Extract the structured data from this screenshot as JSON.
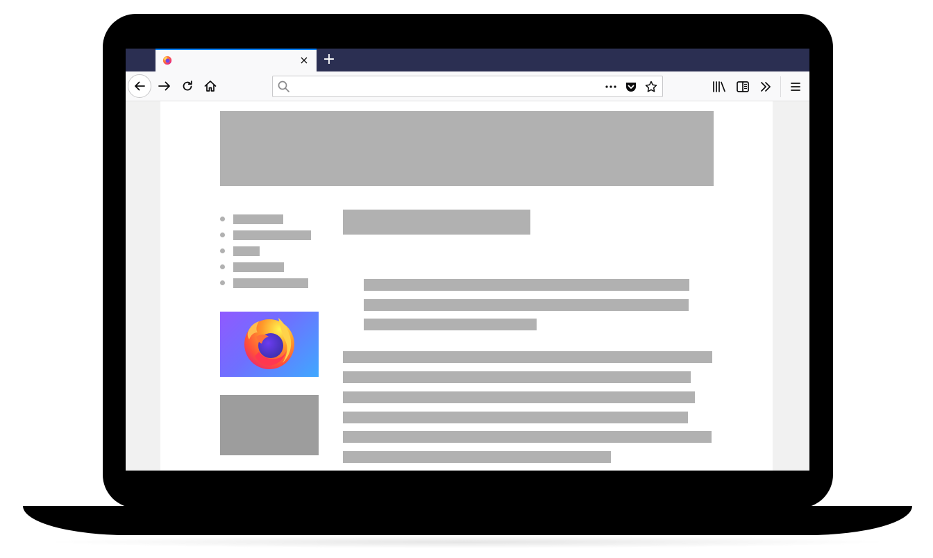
{
  "browser": {
    "tab": {
      "title": "",
      "close_symbol": "×",
      "favicon_icon": "firefox-icon"
    },
    "new_tab_symbol": "+",
    "urlbar": {
      "value": "",
      "placeholder": "",
      "icons": [
        "search-icon",
        "page-actions-icon",
        "pocket-icon",
        "bookmark-star-icon"
      ]
    },
    "nav_icons": [
      "back-icon",
      "forward-icon",
      "reload-icon",
      "home-icon"
    ],
    "toolbar_icons": [
      "library-icon",
      "sidebar-icon",
      "overflow-chevron-icon",
      "menu-hamburger-icon"
    ]
  },
  "page": {
    "sidebar_list_count": 5,
    "paragraph_line_count": 6,
    "blockquote_line_count": 3
  },
  "colors": {
    "tabstrip": "#2b2f52",
    "tab_accent": "#0a84ff",
    "placeholder": "#b1b1b1",
    "placeholder_dark": "#9d9d9d"
  }
}
